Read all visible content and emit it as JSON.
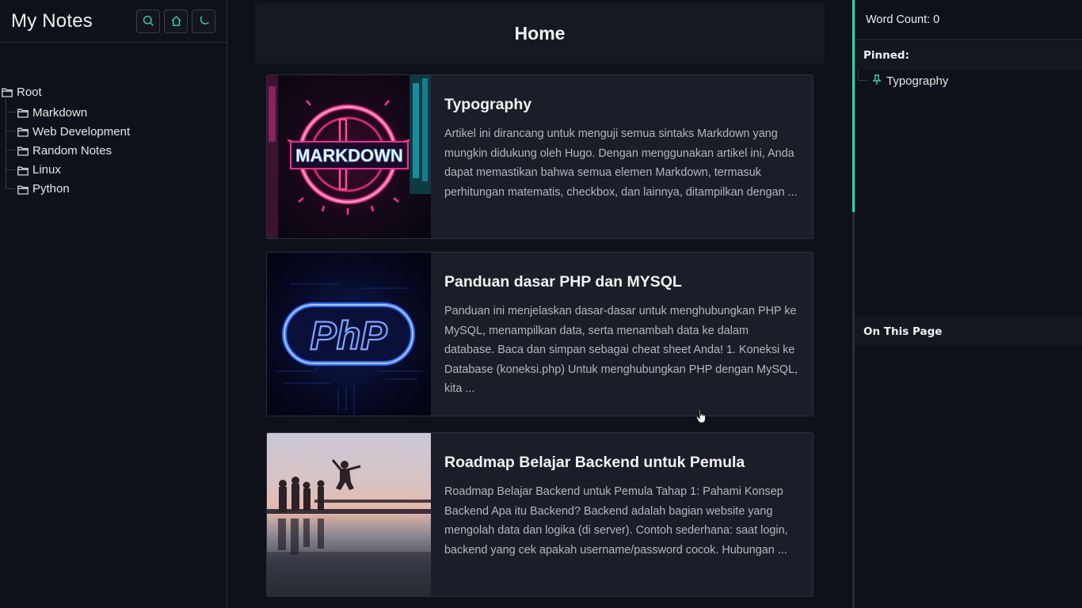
{
  "sidebar": {
    "title": "My Notes",
    "actions": [
      {
        "name": "search-icon"
      },
      {
        "name": "home-icon"
      },
      {
        "name": "moon-icon"
      }
    ],
    "tree": {
      "root": "Root",
      "items": [
        {
          "label": "Markdown"
        },
        {
          "label": "Web Development"
        },
        {
          "label": "Random Notes"
        },
        {
          "label": "Linux"
        },
        {
          "label": "Python"
        }
      ]
    }
  },
  "main": {
    "title": "Home",
    "cards": [
      {
        "title": "Typography",
        "excerpt": "Artikel ini dirancang untuk menguji semua sintaks Markdown yang mungkin didukung oleh Hugo. Dengan menggunakan artikel ini, Anda dapat memastikan bahwa semua elemen Markdown, termasuk perhitungan matematis, checkbox, dan lainnya, ditampilkan dengan ...",
        "thumb_text": "MARKDOWN"
      },
      {
        "title": "Panduan dasar PHP dan MYSQL",
        "excerpt": "Panduan ini menjelaskan dasar-dasar untuk menghubungkan PHP ke MySQL, menampilkan data, serta menambah data ke dalam database. Baca dan simpan sebagai cheat sheet Anda! 1. Koneksi ke Database (koneksi.php) Untuk menghubungkan PHP dengan MySQL, kita ...",
        "thumb_text": "PhP"
      },
      {
        "title": "Roadmap Belajar Backend untuk Pemula",
        "excerpt": "Roadmap Belajar Backend untuk Pemula Tahap 1: Pahami Konsep Backend Apa itu Backend? Backend adalah bagian website yang mengolah data dan logika (di server). Contoh sederhana: saat login, backend yang cek apakah username/password cocok. Hubungan ..."
      }
    ]
  },
  "rightbar": {
    "word_count": "Word Count: 0",
    "pinned_label": "Pinned:",
    "pinned_items": [
      {
        "label": "Typography"
      }
    ],
    "toc_label": "On This Page"
  },
  "colors": {
    "accent": "#2fd6a8",
    "background": "#0f111a",
    "card": "#1b1d28"
  }
}
